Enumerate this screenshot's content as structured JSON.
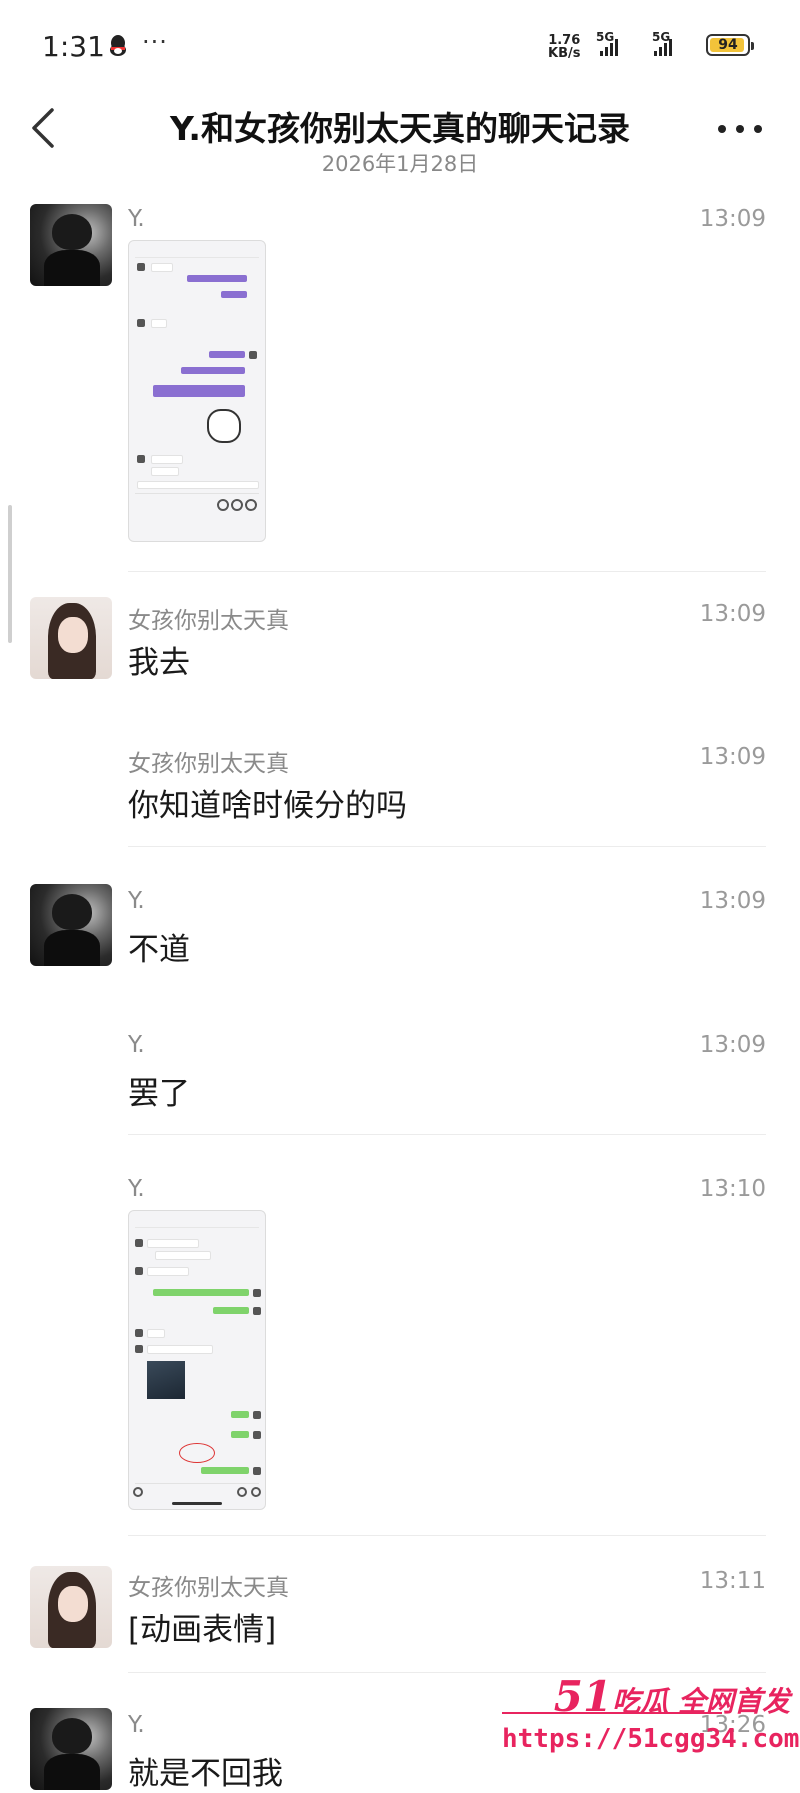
{
  "status_bar": {
    "time": "1:31",
    "more": "···",
    "speed_value": "1.76",
    "speed_unit": "KB/s",
    "net1": "5G",
    "net2": "5G",
    "battery": "94",
    "battery_level": 0.94,
    "battery_color": "#f2c33a",
    "icons": [
      "qq-icon",
      "signal-icon",
      "battery-icon"
    ]
  },
  "header": {
    "title": "Y.和女孩你别太天真的聊天记录",
    "date": "2026年1月28日",
    "back_icon": "chevron-left-icon",
    "more_icon": "more-dots-icon"
  },
  "messages": [
    {
      "sender": "Y.",
      "time": "13:09",
      "type": "image",
      "content": ""
    },
    {
      "sender": "女孩你别太天真",
      "time": "13:09",
      "type": "text",
      "content": "我去"
    },
    {
      "sender": "女孩你别太天真",
      "time": "13:09",
      "type": "text",
      "content": "你知道啥时候分的吗"
    },
    {
      "sender": "Y.",
      "time": "13:09",
      "type": "text",
      "content": "不道"
    },
    {
      "sender": "Y.",
      "time": "13:09",
      "type": "text",
      "content": "罢了"
    },
    {
      "sender": "Y.",
      "time": "13:10",
      "type": "image",
      "content": ""
    },
    {
      "sender": "女孩你别太天真",
      "time": "13:11",
      "type": "text",
      "content": "[动画表情]"
    },
    {
      "sender": "Y.",
      "time": "13:26",
      "type": "text",
      "content": "就是不回我"
    }
  ],
  "watermark": {
    "big": "51",
    "label": "吃瓜 全网首发",
    "url": "https://51cgg34.com",
    "color": "#e8245f"
  }
}
